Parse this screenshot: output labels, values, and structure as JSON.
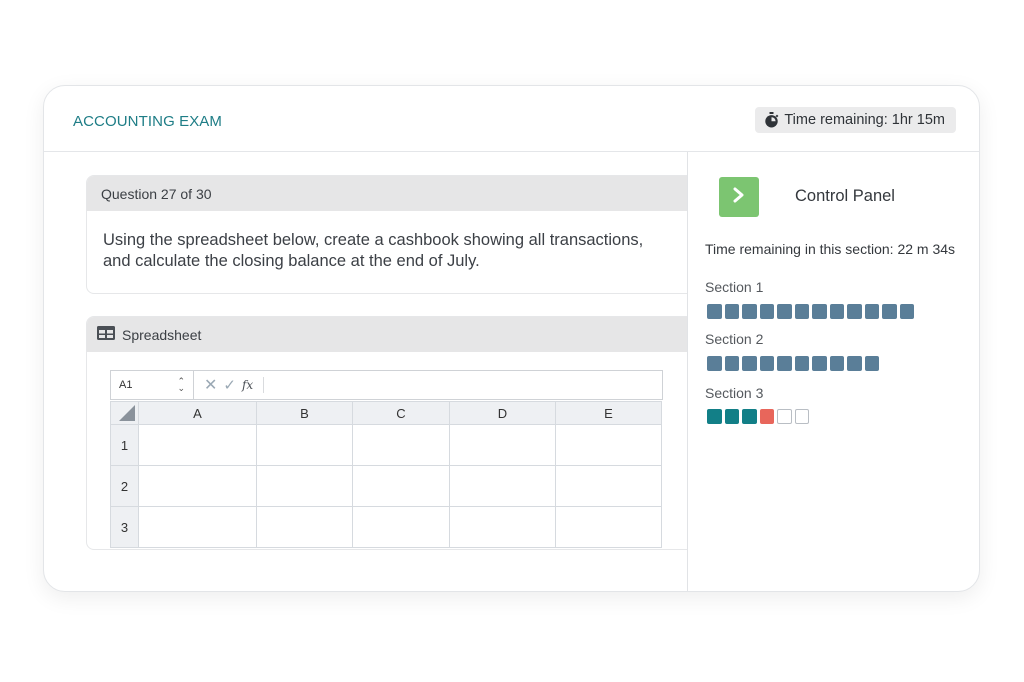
{
  "header": {
    "exam_title": "ACCOUNTING EXAM",
    "time_remaining": "Time remaining: 1hr 15m",
    "timer_icon": "stopwatch-icon"
  },
  "question": {
    "number_label": "Question 27 of 30",
    "text": "Using the spreadsheet below, create a cashbook showing all transactions, and calculate the closing balance at the end of July."
  },
  "spreadsheet": {
    "title": "Spreadsheet",
    "icon": "table-icon",
    "cell_ref": "A1",
    "fx_label": "fx",
    "columns": [
      "A",
      "B",
      "C",
      "D",
      "E"
    ],
    "rows": [
      "1",
      "2",
      "3"
    ]
  },
  "control_panel": {
    "title": "Control Panel",
    "toggle_icon": "chevron-right-icon",
    "section_time": "Time remaining in this section: 22 m 34s",
    "sections": [
      {
        "label": "Section 1",
        "states": [
          "answered",
          "answered",
          "answered",
          "answered",
          "answered",
          "answered",
          "answered",
          "answered",
          "answered",
          "answered",
          "answered",
          "answered"
        ]
      },
      {
        "label": "Section 2",
        "states": [
          "answered",
          "answered",
          "answered",
          "answered",
          "answered",
          "answered",
          "answered",
          "answered",
          "answered",
          "answered"
        ]
      },
      {
        "label": "Section 3",
        "states": [
          "answered",
          "answered",
          "answered",
          "current",
          "empty",
          "empty"
        ]
      }
    ]
  },
  "colors": {
    "accent": "#1e7d86",
    "section_done": "#5a7e98",
    "section3_answered": "#127f87",
    "current": "#e8665b",
    "control_button": "#7cc571"
  }
}
